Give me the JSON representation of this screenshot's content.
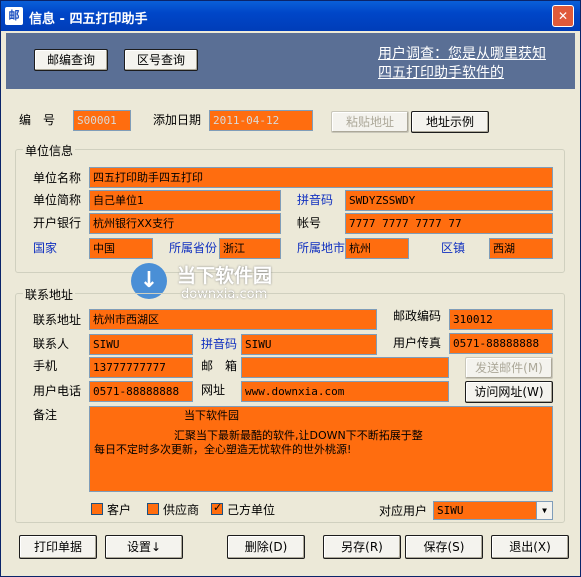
{
  "window": {
    "title": "信息 - 四五打印助手",
    "icon_text": "邮",
    "close_icon": "close-icon"
  },
  "banner": {
    "postcode_btn": "邮编查询",
    "areacode_btn": "区号查询",
    "survey_line1": "用户调查：您是从哪里获知",
    "survey_line2": "四五打印助手软件的"
  },
  "top": {
    "number_label": "编　号",
    "number_value": "S00001",
    "date_label": "添加日期",
    "date_value": "2011-04-12",
    "paste_btn": "粘贴地址",
    "example_btn": "地址示例"
  },
  "unit": {
    "legend": "单位信息",
    "name_label": "单位名称",
    "name_value": "四五打印助手四五打印",
    "short_label": "单位简称",
    "short_value": "自己单位1",
    "pinyin_label": "拼音码",
    "pinyin_value": "SWDYZSSWDY",
    "bank_label": "开户银行",
    "bank_value": "杭州银行XX支行",
    "account_label": "帐号",
    "account_value": "7777 7777 7777 77",
    "country_label": "国家",
    "country_value": "中国",
    "province_label": "所属省份",
    "province_value": "浙江",
    "city_label": "所属地市",
    "city_value": "杭州",
    "district_label": "区镇",
    "district_value": "西湖"
  },
  "contact": {
    "legend": "联系地址",
    "address_label": "联系地址",
    "address_value": "杭州市西湖区",
    "postcode_label": "邮政编码",
    "postcode_value": "310012",
    "person_label": "联系人",
    "person_value": "SIWU",
    "pinyin_label": "拼音码",
    "pinyin_value": "SIWU",
    "fax_label": "用户传真",
    "fax_value": "0571-88888888",
    "mobile_label": "手机",
    "mobile_value": "13777777777",
    "email_label": "邮　箱",
    "email_value": "",
    "send_mail_btn": "发送邮件(M)",
    "phone_label": "用户电话",
    "phone_value": "0571-88888888",
    "website_label": "网址",
    "website_value": "www.downxia.com",
    "visit_btn": "访问网址(W)",
    "memo_label": "备注",
    "memo_line1": "当下软件园",
    "memo_line2": "汇聚当下最新最酷的软件,让DOWN下不断拓展于整",
    "memo_line3": "每日不定时多次更新，全心塑造无忧软件的世外桃源!"
  },
  "flags": {
    "customer_label": "客户",
    "customer_checked": false,
    "supplier_label": "供应商",
    "supplier_checked": false,
    "self_label": "己方单位",
    "self_checked": true,
    "user_label": "对应用户",
    "user_value": "SIWU"
  },
  "bottom": {
    "print_btn": "打印单据",
    "settings_btn": "设置↓",
    "delete_btn": "删除(D)",
    "saveas_btn": "另存(R)",
    "save_btn": "保存(S)",
    "exit_btn": "退出(X)"
  },
  "watermark": {
    "title": "当下软件园",
    "sub": "downxia.com"
  },
  "colors": {
    "field_bg": "#ff6d0f",
    "banner_bg": "#5a6f95",
    "label_blue": "#1030c0"
  }
}
